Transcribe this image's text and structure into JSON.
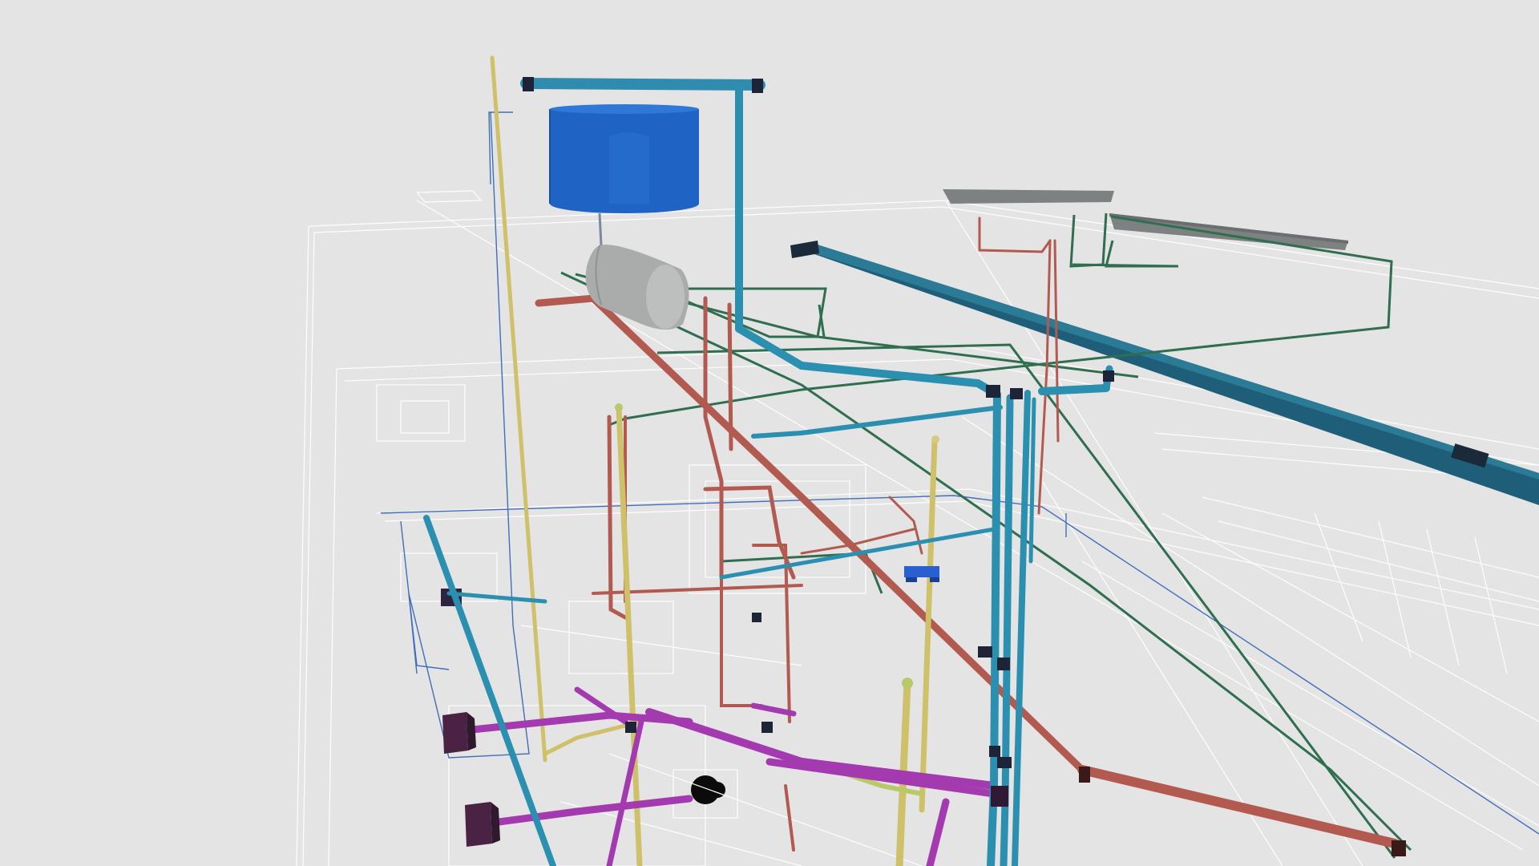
{
  "scene": {
    "background": "#e4e4e4",
    "plan_line_color": "#ffffff"
  },
  "systems": [
    {
      "name": "cold-water-supply",
      "color": "#2b8fb0"
    },
    {
      "name": "hot-water-return",
      "color": "#b35a50"
    },
    {
      "name": "gas-line",
      "color": "#cfc06a"
    },
    {
      "name": "drainage",
      "color": "#a43ab0"
    },
    {
      "name": "solar-loop",
      "color": "#2f6e4f"
    },
    {
      "name": "main-duct",
      "color": "#1f5e78"
    }
  ],
  "equipment": [
    {
      "name": "water-tank",
      "color": "#1f63c4"
    },
    {
      "name": "boiler-cylinder",
      "color": "#a9acab"
    },
    {
      "name": "solar-panel",
      "color": "#7d8181"
    }
  ]
}
